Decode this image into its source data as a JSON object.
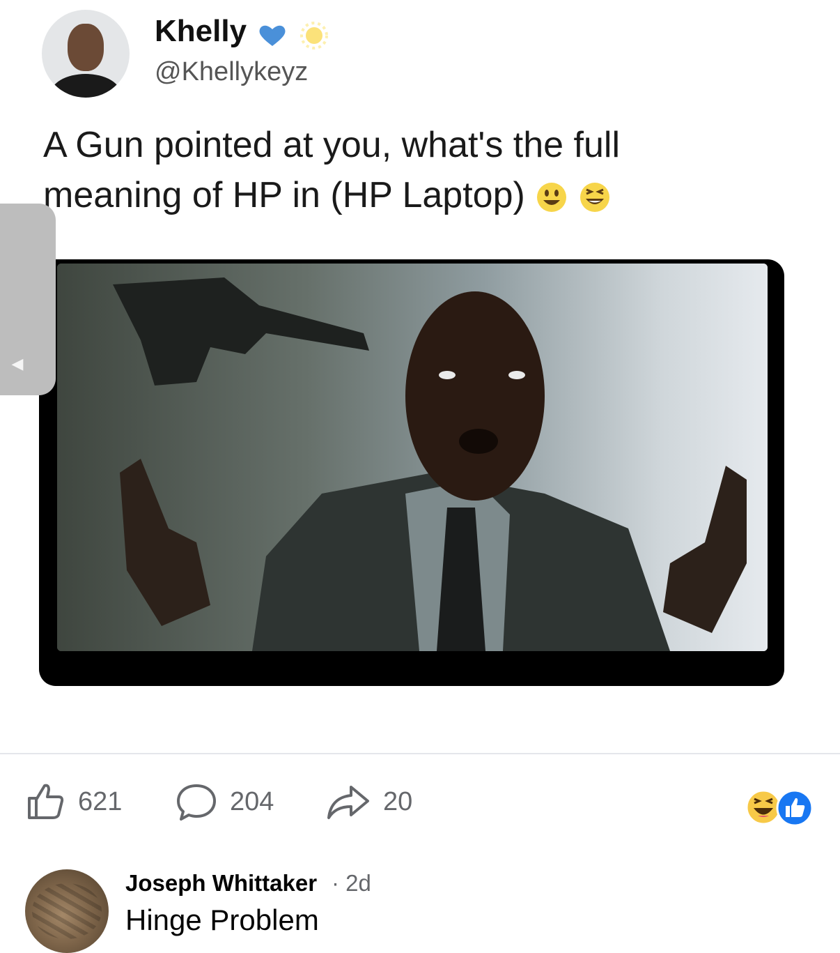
{
  "tweet": {
    "name": "Khelly",
    "handle": "@Khellykeyz",
    "text": "A Gun pointed at you, what's the full meaning of HP in (HP Laptop)",
    "emojis": [
      "grinning-face",
      "laughing-face"
    ]
  },
  "post_actions": {
    "likes": "621",
    "comments": "204",
    "shares": "20"
  },
  "reactions": [
    "haha",
    "like"
  ],
  "comment": {
    "author": "Joseph Whittaker",
    "time": "· 2d",
    "text": "Hinge Problem"
  },
  "colors": {
    "facebook_blue": "#1877f2",
    "muted_text": "#65676b",
    "heart_blue": "#4a90d9",
    "emoji_yellow": "#f7c948"
  }
}
